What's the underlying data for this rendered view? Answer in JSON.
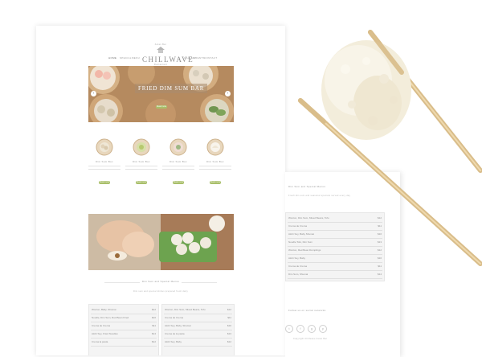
{
  "nav": {
    "left": [
      "Home",
      "Special",
      "Menu",
      "About"
    ],
    "right": [
      "Gallery",
      "Events",
      "Contact"
    ]
  },
  "logo": {
    "tagline": "Asian Bar",
    "title": "CHILLWAVE",
    "subtitle": "Restaurant"
  },
  "hero": {
    "headline": "FRIED DIM SUM BAR",
    "button_label": "Read more"
  },
  "features": [
    {
      "title": "Dim Sum Box",
      "button_label": "Read more"
    },
    {
      "title": "Dim Sum Box",
      "button_label": "Read more"
    },
    {
      "title": "Dim Sum Box",
      "button_label": "Read more"
    },
    {
      "title": "Dim Sum Box",
      "button_label": "Read more"
    }
  ],
  "section": {
    "title": "Dim Sum and Special Menus",
    "subtitle": "Dim sum and special dishes prepared fresh daily"
  },
  "menu_left": [
    {
      "name": "Wonton, Baby, Shumai",
      "price": "$12"
    },
    {
      "name": "Noodle, Dim Sum, Red Bean Fried",
      "price": "$10"
    },
    {
      "name": "Crema de Crema",
      "price": "$11"
    },
    {
      "name": "Alohi Soy, Fried Noodles",
      "price": "$14"
    },
    {
      "name": "Crema la pasta",
      "price": "$12"
    }
  ],
  "menu_right": [
    {
      "name": "Wonton, Dim Sum, Mixed Beans, Tofu",
      "price": "$12"
    },
    {
      "name": "Crema de Crema",
      "price": "$11"
    },
    {
      "name": "Alohi Soy, Baby, Shumai",
      "price": "$10"
    },
    {
      "name": "Crema de la pasta",
      "price": "$13"
    },
    {
      "name": "Alohi Soy, Baby",
      "price": "$12"
    }
  ],
  "second_card": {
    "section_title": "Dim Sum and Special Menus",
    "intro": "Fresh dim sum and seasonal specials served every day",
    "menu": [
      {
        "name": "Wonton, Dim Sum, Mixed Beans, Tofu",
        "price": "$12"
      },
      {
        "name": "Crema de Crema",
        "price": "$11"
      },
      {
        "name": "Alohi Soy, Baby Shumai",
        "price": "$10"
      },
      {
        "name": "Noodle Tofu, Dim Sum",
        "price": "$13"
      },
      {
        "name": "Wonton, Red Bean Dumplings",
        "price": "$12"
      },
      {
        "name": "Alohi Soy, Baby",
        "price": "$10"
      },
      {
        "name": "Crema de Crema",
        "price": "$11"
      },
      {
        "name": "Dim Sum, Shumai",
        "price": "$14"
      }
    ],
    "follow_title": "Follow us on social networks",
    "social_icons": [
      "twitter-icon",
      "facebook-icon",
      "google-plus-icon",
      "pinterest-icon"
    ],
    "social_glyphs": [
      "t",
      "f",
      "g",
      "p"
    ],
    "footer_text": "Copyright Chillwave Asian Bar"
  },
  "colors": {
    "accent": "#a9bf6a",
    "wood": "#c9a57c",
    "rice": "#f7f2e2",
    "chopstick": "#d9bd8a"
  }
}
